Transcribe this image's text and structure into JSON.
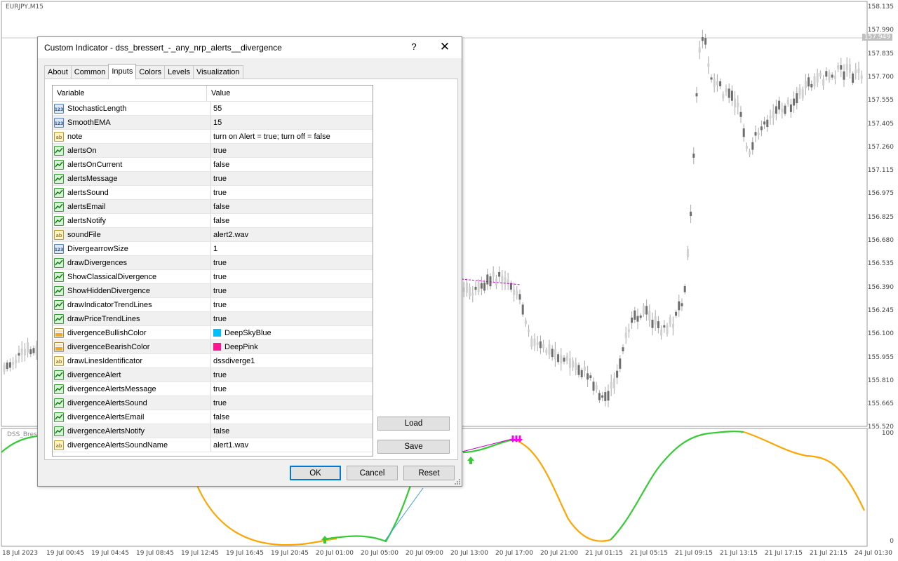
{
  "chart": {
    "symbol": "EURJPY,M15",
    "indicator_label": "DSS_Bresse",
    "current_price": "157.949",
    "price_axis": [
      "158.135",
      "157.990",
      "157.835",
      "157.700",
      "157.555",
      "157.405",
      "157.260",
      "157.115",
      "156.975",
      "156.825",
      "156.680",
      "156.535",
      "156.390",
      "156.245",
      "156.100",
      "155.955",
      "155.810",
      "155.665",
      "155.520"
    ],
    "indicator_axis": [
      "100",
      "0"
    ],
    "time_axis": [
      "18 Jul 2023",
      "19 Jul 00:45",
      "19 Jul 04:45",
      "19 Jul 08:45",
      "19 Jul 12:45",
      "19 Jul 16:45",
      "19 Jul 20:45",
      "20 Jul 01:00",
      "20 Jul 05:00",
      "20 Jul 09:00",
      "20 Jul 13:00",
      "20 Jul 17:00",
      "20 Jul 21:00",
      "21 Jul 01:15",
      "21 Jul 05:15",
      "21 Jul 09:15",
      "21 Jul 13:15",
      "21 Jul 17:15",
      "21 Jul 21:15",
      "24 Jul 01:30"
    ],
    "colors": {
      "bull": "#33cc33",
      "bear": "#ffa500",
      "down_arrow": "#ff00ff",
      "candle": "#a0a0a0",
      "divergence_line": "#cc00cc"
    }
  },
  "dialog": {
    "title": "Custom Indicator - dss_bressert_-_any_nrp_alerts__divergence",
    "help_label": "?",
    "close_label": "✕",
    "tabs": [
      "About",
      "Common",
      "Inputs",
      "Colors",
      "Levels",
      "Visualization"
    ],
    "active_tab": "Inputs",
    "columns": {
      "variable": "Variable",
      "value": "Value"
    },
    "rows": [
      {
        "type": "int",
        "name": "StochasticLength",
        "value": "55"
      },
      {
        "type": "int",
        "name": "SmoothEMA",
        "value": "15"
      },
      {
        "type": "str",
        "name": "note",
        "value": "turn on Alert = true; turn off = false"
      },
      {
        "type": "bool",
        "name": "alertsOn",
        "value": "true"
      },
      {
        "type": "bool",
        "name": "alertsOnCurrent",
        "value": "false"
      },
      {
        "type": "bool",
        "name": "alertsMessage",
        "value": "true"
      },
      {
        "type": "bool",
        "name": "alertsSound",
        "value": "true"
      },
      {
        "type": "bool",
        "name": "alertsEmail",
        "value": "false"
      },
      {
        "type": "bool",
        "name": "alertsNotify",
        "value": "false"
      },
      {
        "type": "str",
        "name": "soundFile",
        "value": "alert2.wav"
      },
      {
        "type": "int",
        "name": "DivergearrowSize",
        "value": "1"
      },
      {
        "type": "bool",
        "name": "drawDivergences",
        "value": "true"
      },
      {
        "type": "bool",
        "name": "ShowClassicalDivergence",
        "value": "true"
      },
      {
        "type": "bool",
        "name": "ShowHiddenDivergence",
        "value": "true"
      },
      {
        "type": "bool",
        "name": "drawIndicatorTrendLines",
        "value": "true"
      },
      {
        "type": "bool",
        "name": "drawPriceTrendLines",
        "value": "true"
      },
      {
        "type": "color",
        "name": "divergenceBullishColor",
        "value": "DeepSkyBlue",
        "swatch": "#00bfff"
      },
      {
        "type": "color",
        "name": "divergenceBearishColor",
        "value": "DeepPink",
        "swatch": "#ff1493"
      },
      {
        "type": "str",
        "name": "drawLinesIdentificator",
        "value": "dssdiverge1"
      },
      {
        "type": "bool",
        "name": "divergenceAlert",
        "value": "true"
      },
      {
        "type": "bool",
        "name": "divergenceAlertsMessage",
        "value": "true"
      },
      {
        "type": "bool",
        "name": "divergenceAlertsSound",
        "value": "true"
      },
      {
        "type": "bool",
        "name": "divergenceAlertsEmail",
        "value": "false"
      },
      {
        "type": "bool",
        "name": "divergenceAlertsNotify",
        "value": "false"
      },
      {
        "type": "str",
        "name": "divergenceAlertsSoundName",
        "value": "alert1.wav"
      }
    ],
    "buttons": {
      "load": "Load",
      "save": "Save",
      "ok": "OK",
      "cancel": "Cancel",
      "reset": "Reset"
    }
  }
}
